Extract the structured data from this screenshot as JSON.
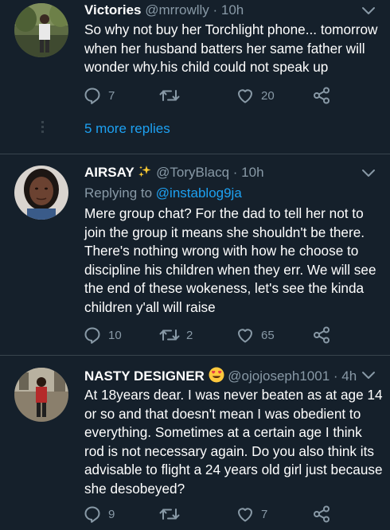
{
  "tweets": [
    {
      "name": "Victories",
      "handle": "@mrrowlly",
      "time": "· 10h",
      "text": "So why not buy her Torchlight phone... tomorrow when her husband batters her same father will wonder why.his child could not speak up",
      "replies": "7",
      "retweets": "",
      "likes": "20"
    },
    {
      "name": "AIRSAY",
      "handle": "@ToryBlacq",
      "time": "· 10h",
      "replying_prefix": "Replying to",
      "replying_to": "@instablog9ja",
      "text": "Mere group chat? For the dad to tell her not to join the group it means she shouldn't be there. There's nothing wrong with how he choose to discipline his children when they err. We will see the end of these wokeness, let's see the kinda children y'all will raise",
      "replies": "10",
      "retweets": "2",
      "likes": "65"
    },
    {
      "name": "NASTY DESIGNER",
      "handle": "@ojojoseph1001",
      "time": "· 4h",
      "text": "At 18years dear. I was never beaten as at age 14 or so and that doesn't mean I was obedient to everything. Sometimes at a certain age I think rod is not necessary again. Do you also think its advisable to flight a 24 years old girl just because she desobeyed?",
      "replies": "9",
      "retweets": "",
      "likes": "7"
    }
  ],
  "thread": {
    "more_replies": "5 more replies"
  },
  "colors": {
    "background": "#15202b",
    "text_primary": "#ffffff",
    "text_secondary": "#8899a6",
    "link": "#1da1f2",
    "divider": "#38444d"
  },
  "icons": [
    "reply-icon",
    "retweet-icon",
    "like-icon",
    "share-icon",
    "chevron-down-icon",
    "sparkles-emoji",
    "heart-eyes-emoji"
  ]
}
